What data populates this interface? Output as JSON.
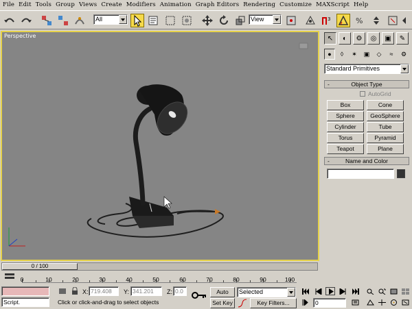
{
  "menu": [
    "File",
    "Edit",
    "Tools",
    "Group",
    "Views",
    "Create",
    "Modifiers",
    "Animation",
    "Graph Editors",
    "Rendering",
    "Customize",
    "MAXScript",
    "Help"
  ],
  "toolbar": {
    "selection_filter": "All",
    "reference_coord": "View"
  },
  "viewport": {
    "label": "Perspective"
  },
  "command_panel": {
    "category": "Standard Primitives",
    "object_type_title": "Object Type",
    "autogrid_label": "AutoGrid",
    "buttons": [
      "Box",
      "Cone",
      "Sphere",
      "GeoSphere",
      "Cylinder",
      "Tube",
      "Torus",
      "Pyramid",
      "Teapot",
      "Plane"
    ],
    "name_color_title": "Name and Color",
    "collapse_symbol": "-",
    "swatch_color": "#333333"
  },
  "timeline": {
    "slider_text": "0 / 100",
    "ticks": [
      "0",
      "10",
      "20",
      "30",
      "40",
      "50",
      "60",
      "70",
      "80",
      "90",
      "100"
    ]
  },
  "status": {
    "script_label": "Script.",
    "prompt": "Click or click-and-drag to select objects",
    "x_label": "X:",
    "x_value": "719.408",
    "y_label": "Y:",
    "y_value": "341.201",
    "z_label": "Z:",
    "z_value": "0.0",
    "auto_key": "Auto Key",
    "set_key": "Set Key",
    "key_mode": "Selected",
    "key_filters": "Key Filters...",
    "frame": "0"
  },
  "colors": {
    "viewport_bg": "#858585",
    "active_border": "#e6d24a",
    "mini_listener": "#e7b8b8"
  }
}
